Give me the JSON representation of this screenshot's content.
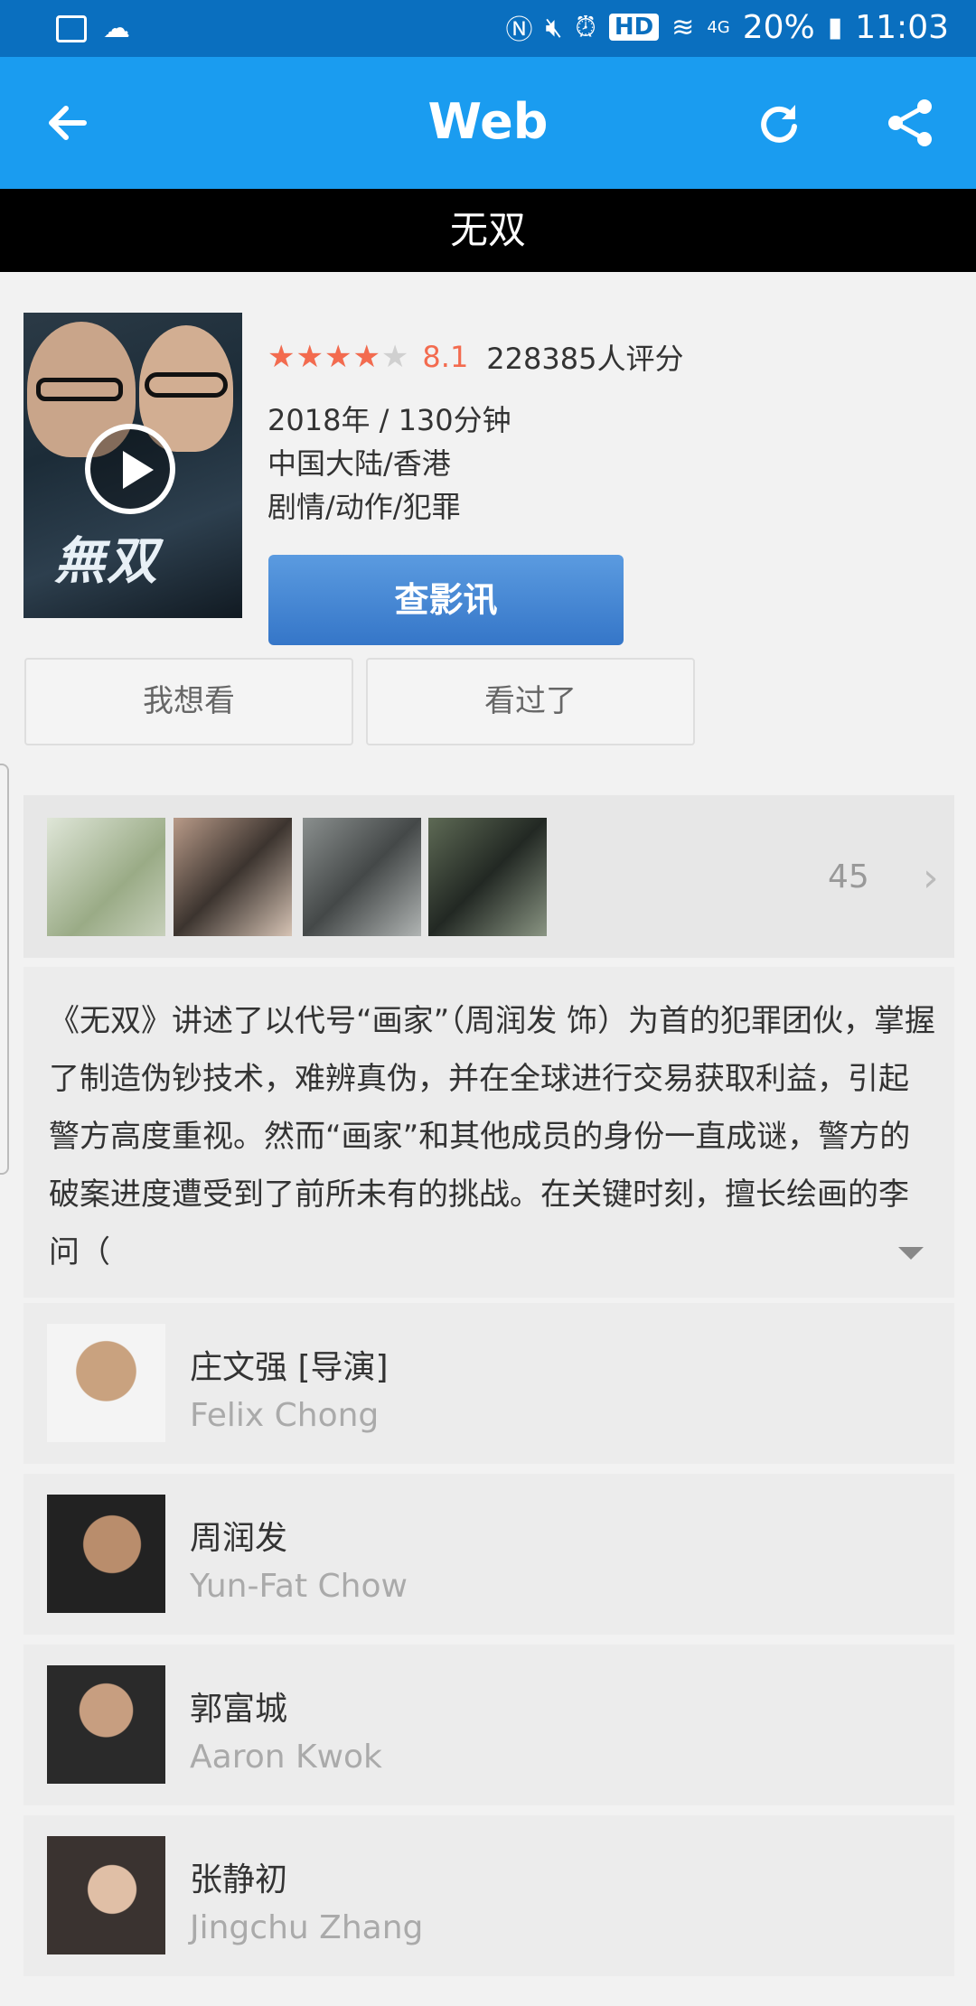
{
  "status_bar": {
    "hd": "HD",
    "network": "4G",
    "battery": "20%",
    "time": "11:03"
  },
  "app_bar": {
    "title": "Web",
    "icons": [
      "back-arrow-icon",
      "refresh-icon",
      "share-icon"
    ]
  },
  "page_title": "无双",
  "movie": {
    "rating_fraction": 0.81,
    "stars": "★★★★★",
    "score": "8.1",
    "votes": "228385人评分",
    "year_duration": "2018年 / 130分钟",
    "region": "中国大陆/香港",
    "genres": "剧情/动作/犯罪",
    "check_info_label": "查影讯",
    "want_label": "我想看",
    "seen_label": "看过了"
  },
  "gallery": {
    "photo_count": "45"
  },
  "synopsis": "《无双》讲述了以代号“画家”（周润发 饰）为首的犯罪团伙，掌握了制造伪钞技术，难辨真伪，并在全球进行交易获取利益，引起警方高度重视。然而“画家”和其他成员的身份一直成谜，警方的破案进度遭受到了前所未有的挑战。在关键时刻，擅长绘画的李问（",
  "cast": [
    {
      "name": "庄文强 [导演]",
      "english": "Felix Chong"
    },
    {
      "name": "周润发",
      "english": "Yun-Fat Chow"
    },
    {
      "name": "郭富城",
      "english": "Aaron Kwok"
    },
    {
      "name": "张静初",
      "english": "Jingchu Zhang"
    }
  ],
  "colors": {
    "status_bar": "#0a6fbf",
    "app_bar": "#1a9cf0",
    "star": "#f36b4f",
    "button": "#3576c8"
  }
}
